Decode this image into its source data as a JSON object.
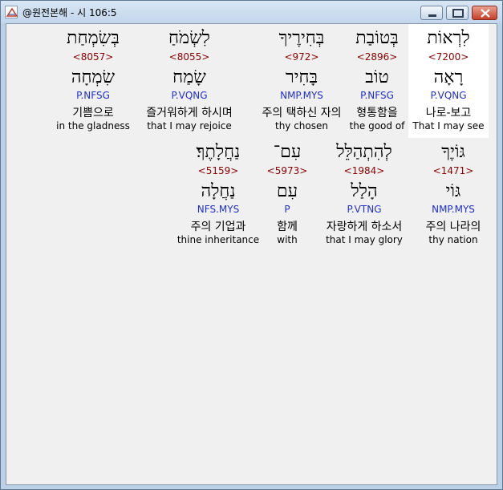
{
  "window": {
    "title": "@원전본해 - 시 106:5",
    "icon": "app-book-icon",
    "buttons": [
      "minimize-icon",
      "maximize-icon",
      "close-icon"
    ],
    "colors": {
      "strong": "#8b0000",
      "morph": "#1f2fd0",
      "selected": "#ffffff"
    }
  },
  "rows": [
    {
      "cells": [
        {
          "hebrew": "לִרְאוֹת",
          "strong": "<7200>",
          "root": "רָאָה",
          "morph": "P.VQNG",
          "korean": "나로-보고",
          "english": "That I may see",
          "selected": true
        },
        {
          "hebrew": "בְּטוֹבַת",
          "strong": "<2896>",
          "root": "טוֹב",
          "morph": "P.NFSG",
          "korean": "형통함을",
          "english": "the good of",
          "selected": false
        },
        {
          "hebrew": "בְּחִירֶיךָ",
          "strong": "<972>",
          "root": "בָּחִיר",
          "morph": "NMP.MYS",
          "korean": "주의 택하신 자의",
          "english": "thy chosen",
          "selected": false
        },
        {
          "hebrew": "לִשְׂמֹחַ",
          "strong": "<8055>",
          "root": "שָׂמַח",
          "morph": "P.VQNG",
          "korean": "즐거워하게 하시며",
          "english": "that I may rejoice",
          "selected": false
        },
        {
          "hebrew": "בְּשִׂמְחַת",
          "strong": "<8057>",
          "root": "שִׂמְחָה",
          "morph": "P.NFSG",
          "korean": "기쁨으로",
          "english": "in the gladness",
          "selected": false
        }
      ]
    },
    {
      "cells": [
        {
          "hebrew": "גּוֹיֶךָ",
          "strong": "<1471>",
          "root": "גּוֹי",
          "morph": "NMP.MYS",
          "korean": "주의 나라의",
          "english": "thy nation",
          "selected": false
        },
        {
          "hebrew": "לְהִתְהַלֵּל",
          "strong": "<1984>",
          "root": "הָלַל",
          "morph": "P.VTNG",
          "korean": "자랑하게 하소서",
          "english": "that I may glory",
          "selected": false
        },
        {
          "hebrew": "עִם־",
          "strong": "<5973>",
          "root": "עִם",
          "morph": "P",
          "korean": "함께",
          "english": "with",
          "selected": false
        },
        {
          "hebrew": "נַחֲלָתֶךָ׃",
          "strong": "<5159>",
          "root": "נַחֲלָה",
          "morph": "NFS.MYS",
          "korean": "주의 기업과",
          "english": "thine inheritance",
          "selected": false
        }
      ]
    }
  ]
}
